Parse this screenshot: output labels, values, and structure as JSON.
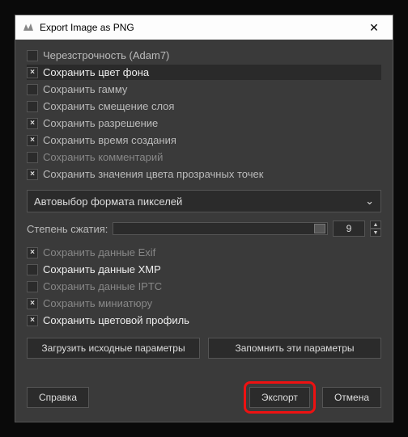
{
  "window": {
    "title": "Export Image as PNG",
    "close": "✕"
  },
  "options": {
    "interlace": {
      "label": "Черезстрочность (Adam7)",
      "checked": false
    },
    "bgcolor": {
      "label": "Сохранить цвет фона",
      "checked": true
    },
    "gamma": {
      "label": "Сохранить гамму",
      "checked": false
    },
    "offset": {
      "label": "Сохранить смещение слоя",
      "checked": false
    },
    "resolution": {
      "label": "Сохранить разрешение",
      "checked": true
    },
    "ctime": {
      "label": "Сохранить время создания",
      "checked": true
    },
    "comment": {
      "label": "Сохранить комментарий",
      "checked": false
    },
    "transp": {
      "label": "Сохранить значения цвета прозрачных точек",
      "checked": true
    }
  },
  "pixelformat": {
    "selected": "Автовыбор формата пикселей"
  },
  "compression": {
    "label": "Степень сжатия:",
    "value": "9"
  },
  "meta": {
    "exif": {
      "label": "Сохранить данные Exif",
      "checked": true
    },
    "xmp": {
      "label": "Сохранить данные XMP",
      "checked": false
    },
    "iptc": {
      "label": "Сохранить данные IPTC",
      "checked": false
    },
    "thumb": {
      "label": "Сохранить миниатюру",
      "checked": true
    },
    "profile": {
      "label": "Сохранить цветовой профиль",
      "checked": true
    }
  },
  "buttons": {
    "load_defaults": "Загрузить исходные параметры",
    "save_defaults": "Запомнить эти параметры",
    "help": "Справка",
    "export": "Экспорт",
    "cancel": "Отмена"
  }
}
